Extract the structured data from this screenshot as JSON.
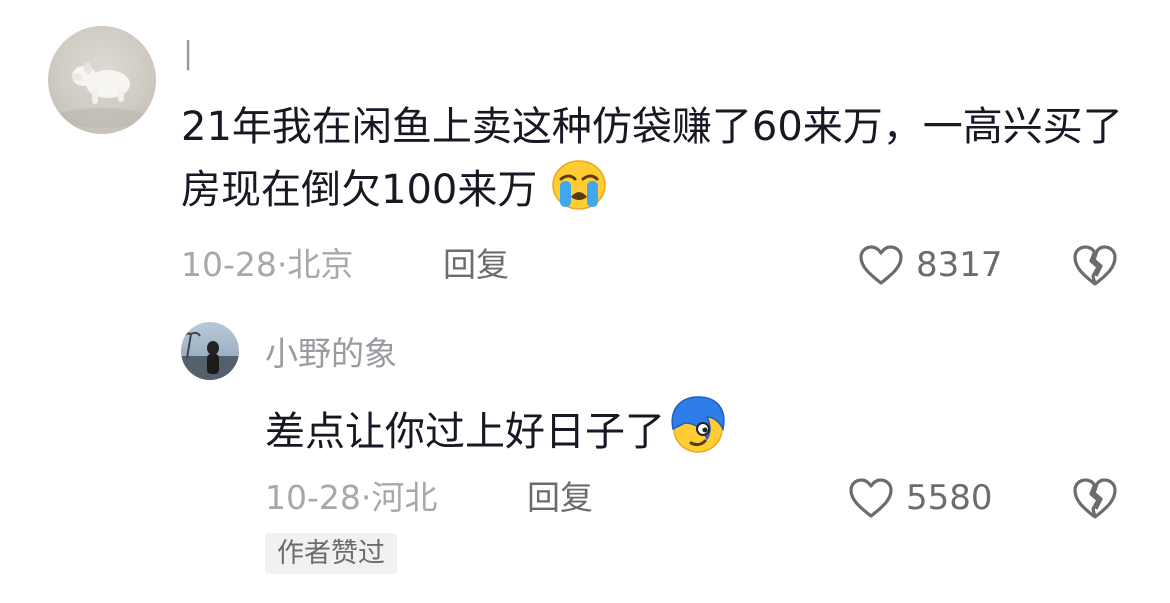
{
  "comments": [
    {
      "username": "|",
      "text": "21年我在闲鱼上卖这种仿袋赚了60来万，一高兴买了房现在倒欠100来万",
      "emoji": "crying-face",
      "date": "10-28",
      "location": "北京",
      "reply_label": "回复",
      "likes": "8317",
      "replies": [
        {
          "username": "小野的象",
          "text": "差点让你过上好日子了",
          "emoji": "blue-hair-smirk-face",
          "date": "10-28",
          "location": "河北",
          "reply_label": "回复",
          "likes": "5580",
          "badge": "作者赞过"
        }
      ]
    }
  ],
  "icons": {
    "like": "heart-outline-icon",
    "dislike": "broken-heart-icon"
  },
  "colors": {
    "primary_text": "#161823",
    "secondary_text": "#a7a8ad",
    "action_text": "#6b6c70"
  }
}
